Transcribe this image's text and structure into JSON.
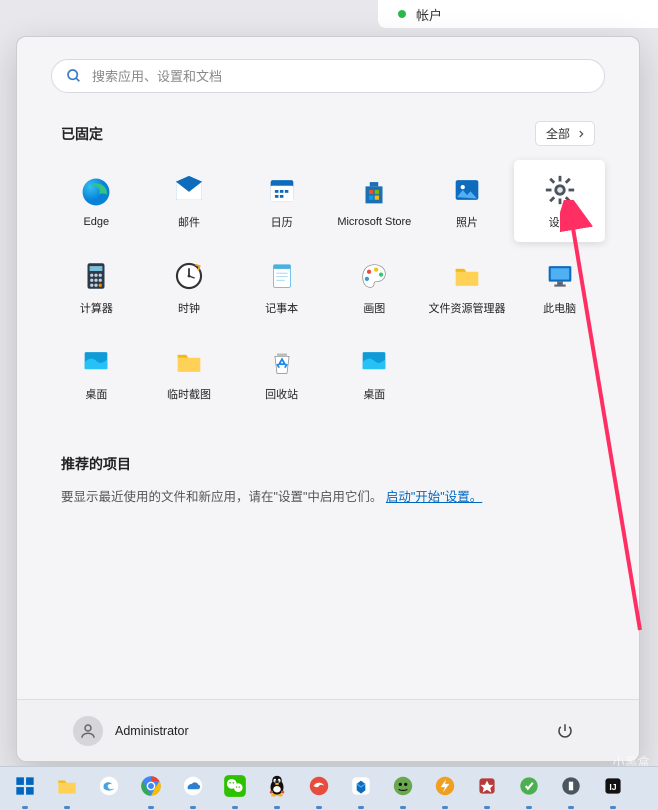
{
  "topFragment": {
    "text": "帐户"
  },
  "search": {
    "placeholder": "搜索应用、设置和文档"
  },
  "pinned": {
    "title": "已固定",
    "allLabel": "全部",
    "apps": [
      {
        "name": "edge",
        "label": "Edge"
      },
      {
        "name": "mail",
        "label": "邮件"
      },
      {
        "name": "calendar",
        "label": "日历"
      },
      {
        "name": "msstore",
        "label": "Microsoft Store"
      },
      {
        "name": "photos",
        "label": "照片"
      },
      {
        "name": "settings",
        "label": "设置",
        "hover": true
      },
      {
        "name": "calculator",
        "label": "计算器"
      },
      {
        "name": "clock",
        "label": "时钟"
      },
      {
        "name": "notepad",
        "label": "记事本"
      },
      {
        "name": "paint",
        "label": "画图"
      },
      {
        "name": "explorer",
        "label": "文件资源管理器"
      },
      {
        "name": "thispc",
        "label": "此电脑"
      },
      {
        "name": "desktop1",
        "label": "桌面"
      },
      {
        "name": "tempshot",
        "label": "临时截图"
      },
      {
        "name": "recycle",
        "label": "回收站"
      },
      {
        "name": "desktop2",
        "label": "桌面"
      }
    ]
  },
  "recommended": {
    "title": "推荐的项目",
    "text": "要显示最近使用的文件和新应用，请在\"设置\"中启用它们。",
    "linkText": "启动\"开始\"设置。"
  },
  "user": {
    "name": "Administrator"
  },
  "taskbar": [
    {
      "name": "start",
      "active": true
    },
    {
      "name": "explorer",
      "active": true
    },
    {
      "name": "sogou",
      "active": false
    },
    {
      "name": "chrome",
      "active": true
    },
    {
      "name": "baidudisk",
      "active": true
    },
    {
      "name": "wechat",
      "active": true
    },
    {
      "name": "qq",
      "active": true
    },
    {
      "name": "todesk",
      "active": true
    },
    {
      "name": "tencentmeeting",
      "active": true
    },
    {
      "name": "clash",
      "active": true
    },
    {
      "name": "thunder",
      "active": true
    },
    {
      "name": "app1",
      "active": true
    },
    {
      "name": "app2",
      "active": true
    },
    {
      "name": "app3",
      "active": true
    },
    {
      "name": "app4",
      "active": true
    }
  ],
  "watermark": "小黑盒"
}
